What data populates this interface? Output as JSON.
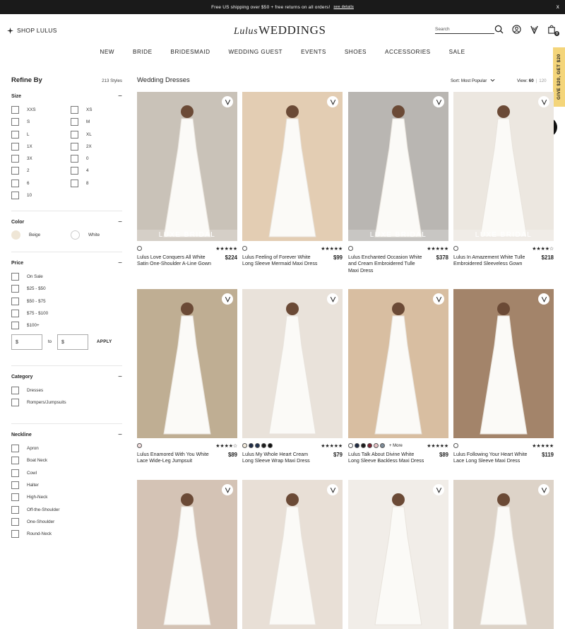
{
  "promo": {
    "text": "Free US shipping over $50 + free returns on all orders!",
    "details": "see details",
    "close": "x"
  },
  "header": {
    "shop_label": "SHOP LULUS",
    "logo_script": "Lulus",
    "logo_main": "WEDDINGS",
    "search_placeholder": "Search",
    "cart_count": "0"
  },
  "nav": [
    "NEW",
    "BRIDE",
    "BRIDESMAID",
    "WEDDING GUEST",
    "EVENTS",
    "SHOES",
    "ACCESSORIES",
    "SALE"
  ],
  "give_tab": "GIVE $20, GET $20",
  "sidebar": {
    "title": "Refine By",
    "count": "213 Styles",
    "size": {
      "title": "Size",
      "toggle": "−",
      "options": [
        "XXS",
        "XS",
        "S",
        "M",
        "L",
        "XL",
        "1X",
        "2X",
        "3X",
        "0",
        "2",
        "4",
        "6",
        "8",
        "10"
      ]
    },
    "color": {
      "title": "Color",
      "toggle": "−",
      "options": [
        {
          "label": "Beige",
          "hex": "#efe6d6"
        },
        {
          "label": "White",
          "hex": "#ffffff"
        }
      ]
    },
    "price": {
      "title": "Price",
      "toggle": "−",
      "options": [
        "On Sale",
        "$25 - $50",
        "$50 - $75",
        "$75 - $100",
        "$100+"
      ],
      "min_placeholder": "$",
      "to": "to",
      "max_placeholder": "$",
      "apply": "APPLY"
    },
    "category": {
      "title": "Category",
      "toggle": "−",
      "options": [
        "Dresses",
        "Rompers/Jumpsuits"
      ]
    },
    "neckline": {
      "title": "Neckline",
      "toggle": "−",
      "options": [
        "Apron",
        "Boat Neck",
        "Cowl",
        "Halter",
        "High-Neck",
        "Off-the-Shoulder",
        "One-Shoulder",
        "Round-Neck"
      ]
    }
  },
  "main": {
    "title": "Wedding Dresses",
    "sort_label": "Sort:",
    "sort_value": "Most Popular",
    "view_label": "View:",
    "view_60": "60",
    "view_sep": "|",
    "view_120": "120"
  },
  "products": [
    {
      "name": "Lulus Love Conquers All White Satin One-Shoulder A-Line Gown",
      "price": "$224",
      "stars": "★★★★★",
      "luxe": "LUXE BRIDAL",
      "swatches": [
        "#ffffff"
      ],
      "more": "",
      "bg": "#c9c2b8"
    },
    {
      "name": "Lulus Feeling of Forever White Long Sleeve Mermaid Maxi Dress",
      "price": "$99",
      "stars": "★★★★★",
      "luxe": "",
      "swatches": [
        "#ffffff"
      ],
      "more": "",
      "bg": "#e3cdb3"
    },
    {
      "name": "Lulus Enchanted Occasion White and Cream Embroidered Tulle Maxi Dress",
      "price": "$378",
      "stars": "★★★★★",
      "luxe": "LUXE BRIDAL",
      "swatches": [
        "#ffffff"
      ],
      "more": "",
      "bg": "#b9b6b2"
    },
    {
      "name": "Lulus In Amazement White Tulle Embroidered Sleeveless Gown",
      "price": "$218",
      "stars": "★★★★☆",
      "luxe": "LUXE BRIDAL",
      "swatches": [
        "#ffffff"
      ],
      "more": "",
      "bg": "#ece7e0"
    },
    {
      "name": "Lulus Enamored With You White Lace Wide-Leg Jumpsuit",
      "price": "$89",
      "stars": "★★★★☆",
      "luxe": "",
      "swatches": [
        "#f3dede"
      ],
      "more": "",
      "bg": "#bfae93"
    },
    {
      "name": "Lulus My Whole Heart Cream Long Sleeve Wrap Maxi Dress",
      "price": "$79",
      "stars": "★★★★★",
      "luxe": "",
      "swatches": [
        "#f4ecde",
        "#1d2a45",
        "#20314f",
        "#1c1c1c",
        "#111111"
      ],
      "more": "",
      "bg": "#e9e2da"
    },
    {
      "name": "Lulus Talk About Divine White Long Sleeve Backless Maxi Dress",
      "price": "$89",
      "stars": "★★★★★",
      "luxe": "",
      "swatches": [
        "#ffffff",
        "#1f2b44",
        "#1a1a1a",
        "#7a2333",
        "#e7c2c6",
        "#7f8d9a"
      ],
      "more": "+ More",
      "bg": "#d8bea1"
    },
    {
      "name": "Lulus Following Your Heart White Lace Long Sleeve Maxi Dress",
      "price": "$119",
      "stars": "★★★★★",
      "luxe": "",
      "swatches": [
        "#ffffff"
      ],
      "more": "",
      "bg": "#a3846a"
    },
    {
      "name": "",
      "price": "",
      "stars": "",
      "luxe": "",
      "swatches": [],
      "more": "",
      "bg": "#d4c3b5"
    },
    {
      "name": "",
      "price": "",
      "stars": "",
      "luxe": "",
      "swatches": [],
      "more": "",
      "bg": "#e8dfd6"
    },
    {
      "name": "",
      "price": "",
      "stars": "",
      "luxe": "",
      "swatches": [],
      "more": "",
      "bg": "#f1ede8"
    },
    {
      "name": "",
      "price": "",
      "stars": "",
      "luxe": "",
      "swatches": [],
      "more": "",
      "bg": "#ddd3c8"
    }
  ]
}
